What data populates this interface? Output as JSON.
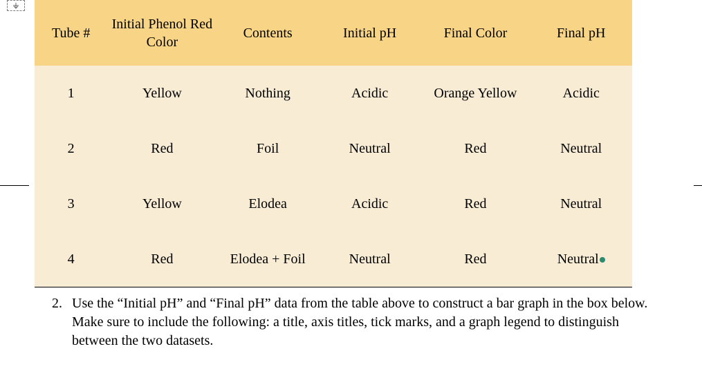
{
  "table": {
    "headers": {
      "tube": "Tube #",
      "initial_color": "Initial Phenol Red Color",
      "contents": "Contents",
      "initial_ph": "Initial pH",
      "final_color": "Final Color",
      "final_ph": "Final pH"
    },
    "rows": [
      {
        "tube": "1",
        "initial_color": "Yellow",
        "contents": "Nothing",
        "initial_ph": "Acidic",
        "final_color": "Orange Yellow",
        "final_ph": "Acidic"
      },
      {
        "tube": "2",
        "initial_color": "Red",
        "contents": "Foil",
        "initial_ph": "Neutral",
        "final_color": "Red",
        "final_ph": "Neutral"
      },
      {
        "tube": "3",
        "initial_color": "Yellow",
        "contents": "Elodea",
        "initial_ph": "Acidic",
        "final_color": "Red",
        "final_ph": "Neutral"
      },
      {
        "tube": "4",
        "initial_color": "Red",
        "contents": "Elodea + Foil",
        "initial_ph": "Neutral",
        "final_color": "Red",
        "final_ph": "Neutral"
      }
    ]
  },
  "instruction": {
    "number": "2.",
    "text": "Use the “Initial pH” and “Final pH” data from the table above to construct a bar graph in the box below. Make sure to include the following: a title, axis titles, tick marks, and a graph legend to distinguish between the two datasets."
  }
}
